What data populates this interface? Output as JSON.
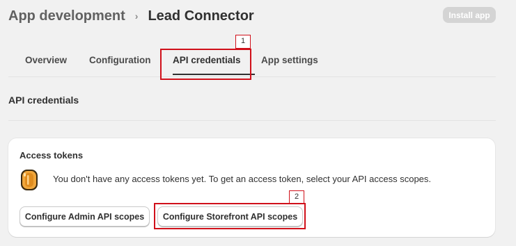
{
  "breadcrumb": {
    "parent": "App development",
    "separator": "›",
    "current": "Lead Connector"
  },
  "install_button": "Install app",
  "tabs": [
    {
      "label": "Overview",
      "active": false
    },
    {
      "label": "Configuration",
      "active": false
    },
    {
      "label": "API credentials",
      "active": true
    },
    {
      "label": "App settings",
      "active": false
    }
  ],
  "section_title": "API credentials",
  "access_tokens": {
    "title": "Access tokens",
    "icon": "coin-icon",
    "empty_message": "You don't have any access tokens yet. To get an access token, select your API access scopes.",
    "buttons": {
      "admin": "Configure Admin API scopes",
      "storefront": "Configure Storefront API scopes"
    }
  },
  "annotations": [
    {
      "label": "1"
    },
    {
      "label": "2"
    }
  ],
  "colors": {
    "background": "#f1f1f1",
    "annotation": "#d0101a",
    "coin": "#f0a63b"
  }
}
